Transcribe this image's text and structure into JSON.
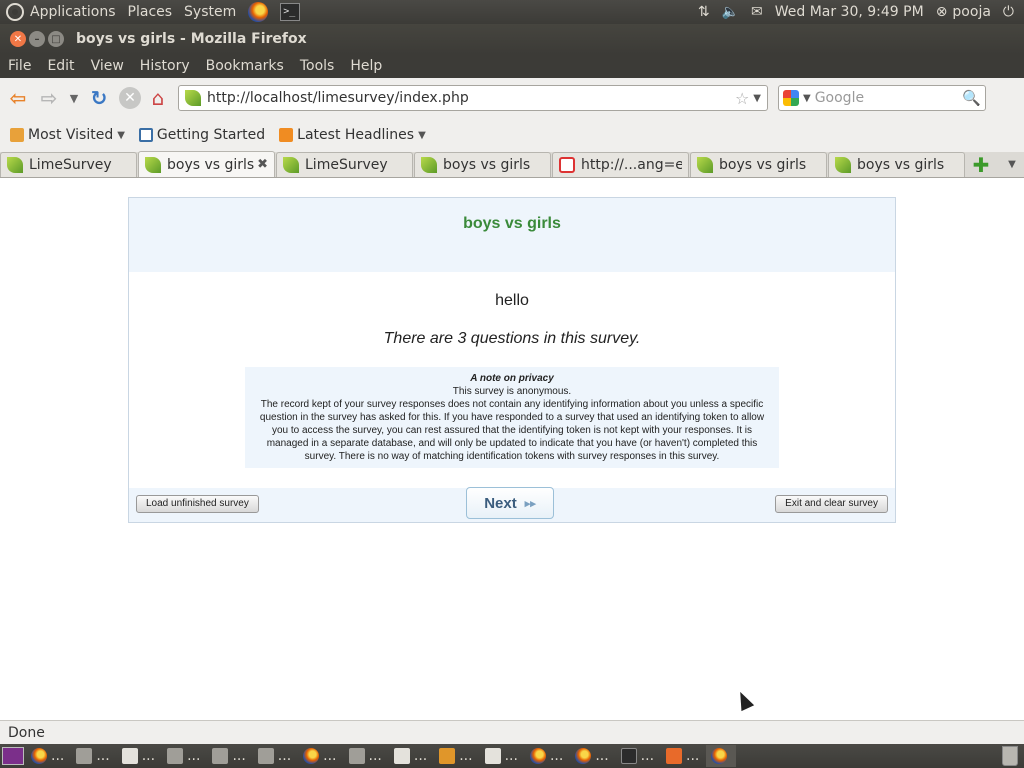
{
  "top_panel": {
    "menus": [
      "Applications",
      "Places",
      "System"
    ],
    "clock": "Wed Mar 30,  9:49 PM",
    "user": "pooja"
  },
  "window": {
    "title": "boys vs girls - Mozilla Firefox"
  },
  "menubar": [
    "File",
    "Edit",
    "View",
    "History",
    "Bookmarks",
    "Tools",
    "Help"
  ],
  "navbar": {
    "url": "http://localhost/limesurvey/index.php",
    "search_placeholder": "Google"
  },
  "bookmarks": [
    "Most Visited",
    "Getting Started",
    "Latest Headlines"
  ],
  "tabs": [
    {
      "label": "LimeSurvey"
    },
    {
      "label": "boys vs girls"
    },
    {
      "label": "LimeSurvey"
    },
    {
      "label": "boys vs girls"
    },
    {
      "label": "http://...ang=en"
    },
    {
      "label": "boys vs girls"
    },
    {
      "label": "boys vs girls"
    }
  ],
  "survey": {
    "title": "boys vs girls",
    "description": "hello",
    "question_count_text": "There are 3 questions in this survey.",
    "privacy_title": "A note on privacy",
    "privacy_subtitle": "This survey is anonymous.",
    "privacy_body": "The record kept of your survey responses does not contain any identifying information about you unless a specific question in the survey has asked for this. If you have responded to a survey that used an identifying token to allow you to access the survey, you can rest assured that the identifying token is not kept with your responses. It is managed in a separate database, and will only be updated to indicate that you have (or haven't) completed this survey. There is no way of matching identification tokens with survey responses in this survey.",
    "load_button": "Load unfinished survey",
    "next_button": "Next",
    "exit_button": "Exit and clear survey"
  },
  "statusbar": {
    "text": "Done"
  },
  "taskbar": {
    "ellipsis": "..."
  },
  "colors": {
    "panel_bg": "#3c3b37",
    "survey_title": "#3a8a3a",
    "survey_header_bg": "#eef5fc"
  }
}
